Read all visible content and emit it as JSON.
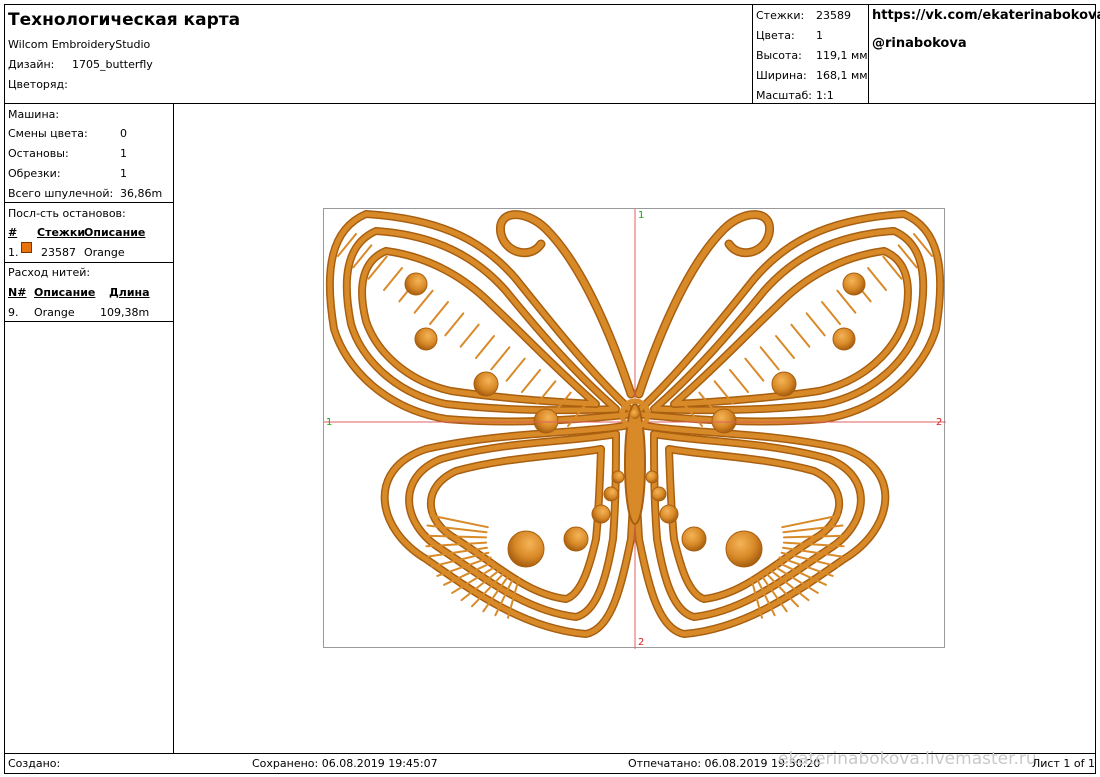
{
  "header": {
    "title": "Технологическая карта",
    "software": "Wilcom EmbroideryStudio",
    "design_label": "Дизайн:",
    "design_name": "1705_butterfly",
    "colorway_label": "Цветоряд:"
  },
  "stats": [
    {
      "label": "Стежки:",
      "value": "23589"
    },
    {
      "label": "Цвета:",
      "value": "1"
    },
    {
      "label": "Высота:",
      "value": "119,1 мм"
    },
    {
      "label": "Ширина:",
      "value": "168,1 мм"
    },
    {
      "label": "Масштаб:",
      "value": "1:1"
    }
  ],
  "links": {
    "vk": "https://vk.com/ekaterinabokova",
    "handle": "@rinabokova"
  },
  "machine": {
    "title": "Машина:",
    "rows": [
      {
        "label": "Смены цвета:",
        "value": "0"
      },
      {
        "label": "Остановы:",
        "value": "1"
      },
      {
        "label": "Обрезки:",
        "value": "1"
      },
      {
        "label": "Всего шпулечной:",
        "value": "36,86m"
      }
    ]
  },
  "stop_sequence": {
    "title": "Посл-сть остановов:",
    "headers": [
      "#",
      "Стежки",
      "Описание"
    ],
    "rows": [
      {
        "num": "1.",
        "stitches": "23587",
        "description": "Orange",
        "color": "#e8720c"
      }
    ]
  },
  "thread_usage": {
    "title": "Расход нитей:",
    "headers": [
      "N#",
      "Описание",
      "Длина"
    ],
    "rows": [
      {
        "num": "9.",
        "description": "Orange",
        "length": "109,38m"
      }
    ]
  },
  "design": {
    "marker_top": "1",
    "marker_left": "1",
    "marker_right": "2",
    "marker_bottom": "2",
    "thread_color": "#d98a28",
    "thread_dark": "#a85f10",
    "thread_light": "#f4b458",
    "axis_color": "#e06060"
  },
  "footer": {
    "created": "Создано:",
    "saved": "Сохранено: 06.08.2019 19:45:07",
    "printed": "Отпечатано: 06.08.2019 19:50:20",
    "watermark": "ekaterinabokova.livemaster.ru",
    "page": "Лист 1 of 1"
  }
}
